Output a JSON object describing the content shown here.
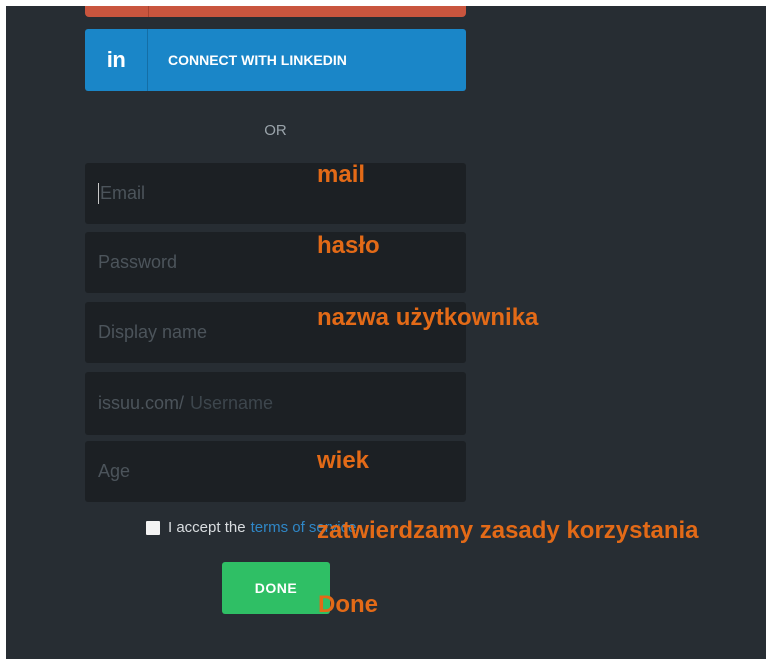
{
  "linkedin": {
    "icon_text": "in",
    "label": "CONNECT WITH LINKEDIN"
  },
  "divider": {
    "text": "OR"
  },
  "form": {
    "email": {
      "placeholder": "Email",
      "value": ""
    },
    "password": {
      "placeholder": "Password",
      "value": ""
    },
    "display_name": {
      "placeholder": "Display name",
      "value": ""
    },
    "username": {
      "prefix": "issuu.com/",
      "placeholder": "Username",
      "value": ""
    },
    "age": {
      "placeholder": "Age",
      "value": ""
    }
  },
  "terms": {
    "text": "I accept the",
    "link": "terms of service",
    "checked": false
  },
  "done_button": {
    "label": "DONE"
  },
  "annotations": {
    "mail": "mail",
    "password": "hasło",
    "display_name": "nazwa użytkownika",
    "age": "wiek",
    "terms": "zatwierdzamy zasady korzystania",
    "done": "Done"
  },
  "colors": {
    "background": "#272d33",
    "linkedin": "#1a86c8",
    "done": "#2fbf65",
    "annotation": "#e36a17",
    "link": "#2f87c7"
  }
}
